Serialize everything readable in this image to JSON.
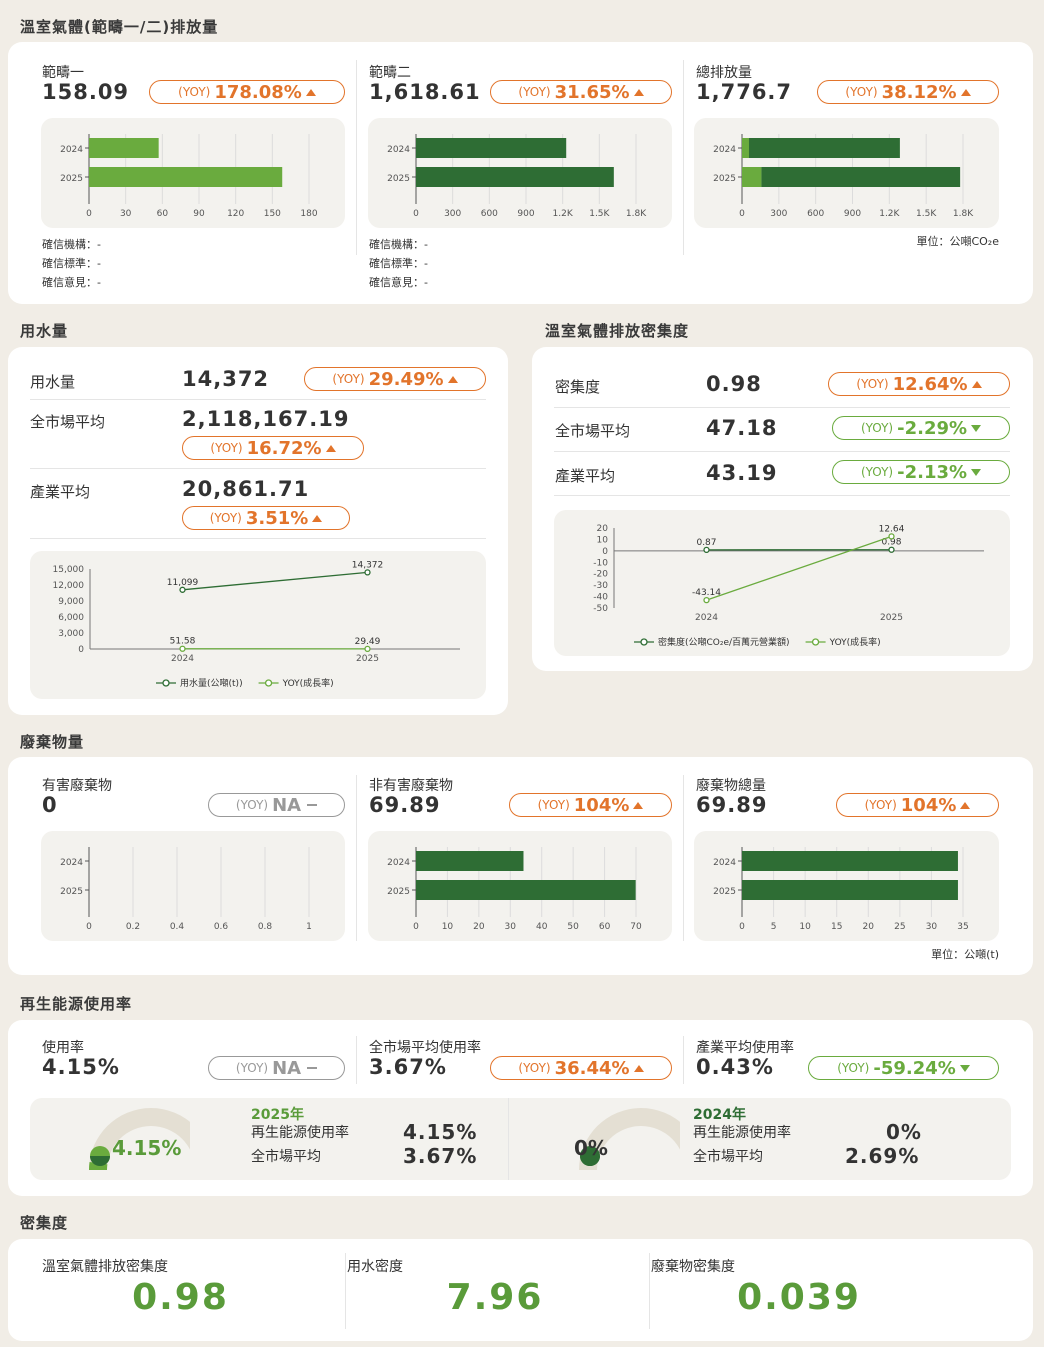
{
  "ghg": {
    "title": "溫室氣體(範疇一/二)排放量",
    "scopes": [
      {
        "label": "範疇一",
        "value": "158.09",
        "yoy_tag": "(YOY)",
        "yoy": "178.08%",
        "dir": "up",
        "axis": [
          "0",
          "30",
          "60",
          "90",
          "120",
          "150",
          "180"
        ],
        "max": 180,
        "years": [
          "2024",
          "2025"
        ],
        "bars": [
          {
            "total": 57
          },
          {
            "total": 158.09
          }
        ],
        "colors": [
          "#6aab3e",
          "#6aab3e"
        ]
      },
      {
        "label": "範疇二",
        "value": "1,618.61",
        "yoy_tag": "(YOY)",
        "yoy": "31.65%",
        "dir": "up",
        "axis": [
          "0",
          "300",
          "600",
          "900",
          "1.2K",
          "1.5K",
          "1.8K"
        ],
        "max": 1800,
        "years": [
          "2024",
          "2025"
        ],
        "bars": [
          {
            "total": 1229
          },
          {
            "total": 1618.61
          }
        ],
        "colors": [
          "#2e6d34",
          "#2e6d34"
        ]
      },
      {
        "label": "總排放量",
        "value": "1,776.7",
        "yoy_tag": "(YOY)",
        "yoy": "38.12%",
        "dir": "up",
        "axis": [
          "0",
          "300",
          "600",
          "900",
          "1.2K",
          "1.5K",
          "1.8K"
        ],
        "max": 1800,
        "years": [
          "2024",
          "2025"
        ],
        "stack": [
          [
            57,
            1229
          ],
          [
            158.09,
            1618.61
          ]
        ]
      }
    ],
    "verify": [
      {
        "org": "確信機構：-",
        "std": "確信標準：-",
        "opinion": "確信意見：-"
      },
      {
        "org": "確信機構：-",
        "std": "確信標準：-",
        "opinion": "確信意見：-"
      }
    ],
    "unit": "單位：公噸CO₂e"
  },
  "water": {
    "title": "用水量",
    "rows": [
      {
        "label": "用水量",
        "value": "14,372",
        "yoy_tag": "(YOY)",
        "yoy": "29.49%",
        "dir": "up"
      },
      {
        "label": "全市場平均",
        "value": "2,118,167.19",
        "yoy_tag": "(YOY)",
        "yoy": "16.72%",
        "dir": "up"
      },
      {
        "label": "產業平均",
        "value": "20,861.71",
        "yoy_tag": "(YOY)",
        "yoy": "3.51%",
        "dir": "up"
      }
    ],
    "chart": {
      "yticks": [
        "15,000",
        "12,000",
        "9,000",
        "6,000",
        "3,000",
        "0"
      ],
      "x": [
        "2024",
        "2025"
      ],
      "usage": [
        11099,
        14372
      ],
      "usage_labels": [
        "11,099",
        "14,372"
      ],
      "yoy": [
        51.58,
        29.49
      ],
      "yoy_labels": [
        "51.58",
        "29.49"
      ],
      "legend": [
        "用水量(公噸(t))",
        "YOY(成長率)"
      ]
    }
  },
  "intensity": {
    "title": "溫室氣體排放密集度",
    "rows": [
      {
        "label": "密集度",
        "value": "0.98",
        "yoy_tag": "(YOY)",
        "yoy": "12.64%",
        "dir": "up"
      },
      {
        "label": "全市場平均",
        "value": "47.18",
        "yoy_tag": "(YOY)",
        "yoy": "-2.29%",
        "dir": "down"
      },
      {
        "label": "產業平均",
        "value": "43.19",
        "yoy_tag": "(YOY)",
        "yoy": "-2.13%",
        "dir": "down"
      }
    ],
    "chart": {
      "yticks": [
        "20",
        "10",
        "0",
        "-10",
        "-20",
        "-30",
        "-40",
        "-50"
      ],
      "x": [
        "2024",
        "2025"
      ],
      "density": [
        0.87,
        0.98
      ],
      "density_labels": [
        "0.87",
        "0.98"
      ],
      "yoy": [
        -43.14,
        12.64
      ],
      "yoy_labels": [
        "-43.14",
        "12.64"
      ],
      "legend": [
        "密集度(公噸CO₂e/百萬元營業額)",
        "YOY(成長率)"
      ]
    }
  },
  "waste": {
    "title": "廢棄物量",
    "items": [
      {
        "label": "有害廢棄物",
        "value": "0",
        "yoy_tag": "(YOY)",
        "yoy": "NA",
        "dir": "none",
        "axis": [
          "0",
          "0.2",
          "0.4",
          "0.6",
          "0.8",
          "1"
        ],
        "max": 1,
        "bars": [
          0,
          0
        ]
      },
      {
        "label": "非有害廢棄物",
        "value": "69.89",
        "yoy_tag": "(YOY)",
        "yoy": "104%",
        "dir": "up",
        "axis": [
          "0",
          "10",
          "20",
          "30",
          "40",
          "50",
          "60",
          "70"
        ],
        "max": 70,
        "bars": [
          34.2,
          69.89
        ]
      },
      {
        "label": "廢棄物總量",
        "value": "69.89",
        "yoy_tag": "(YOY)",
        "yoy": "104%",
        "dir": "up",
        "axis": [
          "0",
          "5",
          "10",
          "15",
          "20",
          "25",
          "30",
          "35"
        ],
        "max": 35,
        "bars": [
          34.2,
          34.2
        ]
      }
    ],
    "years": [
      "2024",
      "2025"
    ],
    "unit": "單位：公噸(t)"
  },
  "renew": {
    "title": "再生能源使用率",
    "items": [
      {
        "label": "使用率",
        "value": "4.15%",
        "yoy_tag": "(YOY)",
        "yoy": "NA",
        "dir": "none"
      },
      {
        "label": "全市場平均使用率",
        "value": "3.67%",
        "yoy_tag": "(YOY)",
        "yoy": "36.44%",
        "dir": "up"
      },
      {
        "label": "產業平均使用率",
        "value": "0.43%",
        "yoy_tag": "(YOY)",
        "yoy": "-59.24%",
        "dir": "down"
      }
    ],
    "years": [
      {
        "gauge": "4.15%",
        "pct": 4.15,
        "year": "2025年",
        "r_label": "再生能源使用率",
        "r_value": "4.15%",
        "m_label": "全市場平均",
        "m_value": "3.67%"
      },
      {
        "gauge": "0%",
        "pct": 0,
        "year": "2024年",
        "r_label": "再生能源使用率",
        "r_value": "0%",
        "m_label": "全市場平均",
        "m_value": "2.69%"
      }
    ]
  },
  "density": {
    "title": "密集度",
    "items": [
      {
        "label": "溫室氣體排放密集度",
        "value": "0.98"
      },
      {
        "label": "用水密度",
        "value": "7.96"
      },
      {
        "label": "廢棄物密集度",
        "value": "0.039"
      }
    ]
  },
  "colors": {
    "orange": "#e2742b",
    "green": "#6aab3e",
    "dark_green": "#2e6d34",
    "gauge_bg": "#e4dfd3"
  }
}
